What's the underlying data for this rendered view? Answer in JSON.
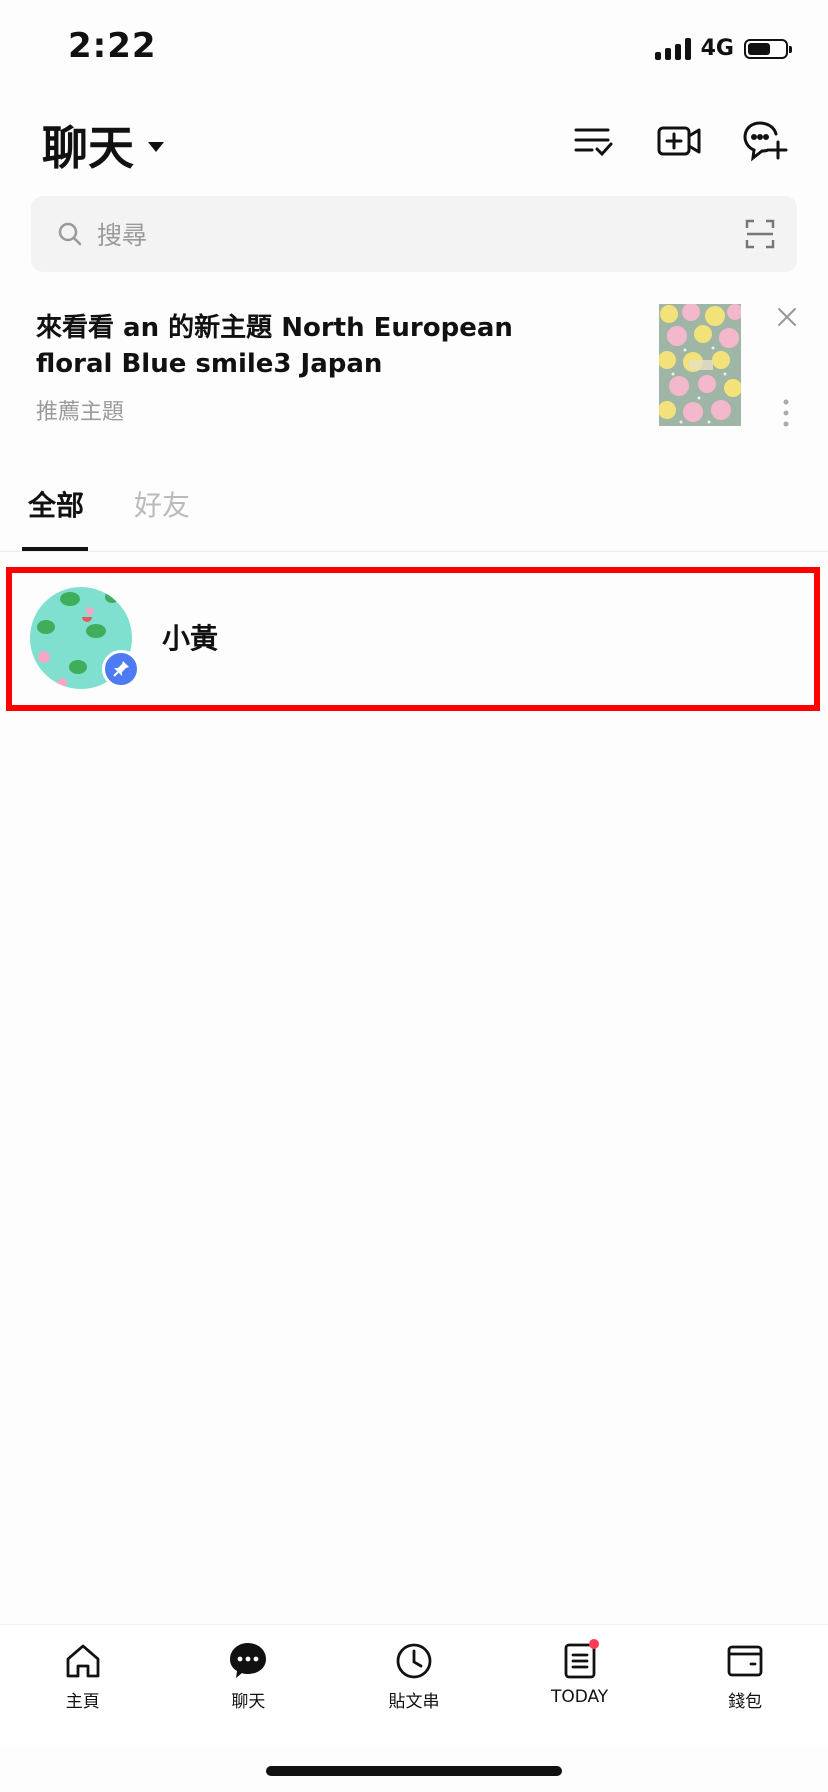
{
  "status_bar": {
    "time": "2:22",
    "network": "4G",
    "battery_level": 0.6
  },
  "header": {
    "title": "聊天",
    "icons": [
      "list-check-icon",
      "video-add-icon",
      "chat-add-icon"
    ]
  },
  "search": {
    "placeholder": "搜尋",
    "icons": [
      "search-icon",
      "scan-icon"
    ]
  },
  "banner": {
    "title": "來看看 an 的新主題 North European floral Blue smile3 Japan",
    "subtitle": "推薦主題",
    "icons": [
      "close-icon",
      "more-vertical-icon"
    ]
  },
  "tabs": [
    {
      "label": "全部",
      "active": true
    },
    {
      "label": "好友",
      "active": false
    }
  ],
  "chats": [
    {
      "name": "小黃",
      "pinned": true,
      "avatar_color": "#7fe0cf"
    }
  ],
  "bottom_nav": [
    {
      "label": "主頁",
      "icon": "home-icon"
    },
    {
      "label": "聊天",
      "icon": "chat-icon",
      "active": true
    },
    {
      "label": "貼文串",
      "icon": "clock-icon"
    },
    {
      "label": "TODAY",
      "icon": "news-icon",
      "badge": true
    },
    {
      "label": "錢包",
      "icon": "wallet-icon"
    }
  ],
  "colors": {
    "pin": "#4e7bf2",
    "highlight": "#ff0000",
    "badge": "#ff3b55"
  }
}
